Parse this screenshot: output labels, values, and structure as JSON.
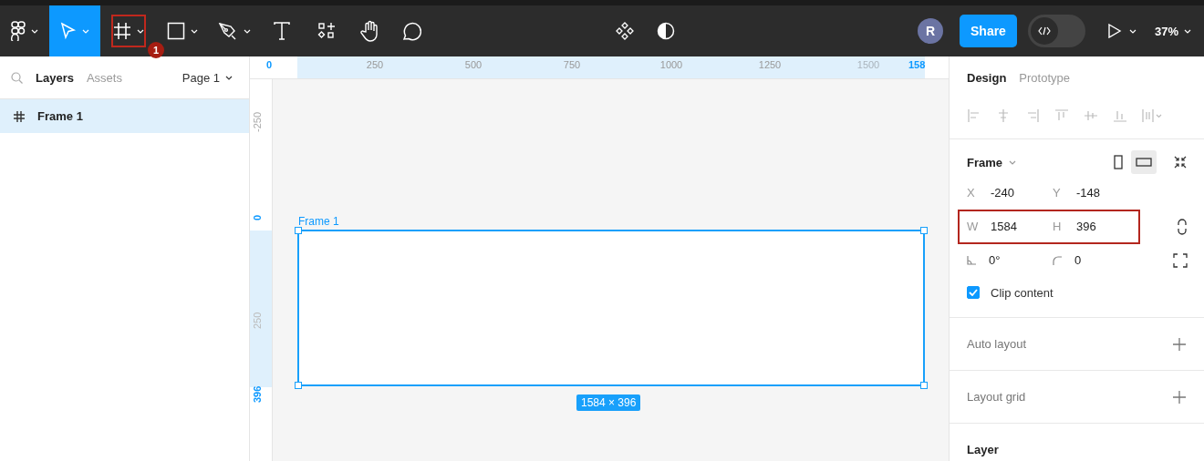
{
  "toolbar": {
    "tools": [
      {
        "kind": "menu",
        "selected": false,
        "dropdown": true,
        "highlighted": false
      },
      {
        "kind": "move",
        "selected": true,
        "dropdown": true,
        "highlighted": false
      },
      {
        "kind": "frame",
        "selected": false,
        "dropdown": true,
        "highlighted": true,
        "badge": "1"
      },
      {
        "kind": "shape",
        "selected": false,
        "dropdown": true,
        "highlighted": false
      },
      {
        "kind": "pen",
        "selected": false,
        "dropdown": true,
        "highlighted": false
      },
      {
        "kind": "text",
        "selected": false,
        "dropdown": false,
        "highlighted": false
      },
      {
        "kind": "resources",
        "selected": false,
        "dropdown": false,
        "highlighted": false
      },
      {
        "kind": "hand",
        "selected": false,
        "dropdown": false,
        "highlighted": false
      },
      {
        "kind": "comment",
        "selected": false,
        "dropdown": false,
        "highlighted": false
      }
    ],
    "avatar": "R",
    "share": "Share",
    "dev_mode": {
      "on": false
    },
    "zoom": "37%"
  },
  "left_panel": {
    "tabs": [
      {
        "label": "Layers",
        "selected": true
      },
      {
        "label": "Assets",
        "selected": false
      }
    ],
    "page": "Page 1",
    "layers": [
      {
        "name": "Frame 1",
        "selected": true
      }
    ]
  },
  "top_ruler": [
    {
      "label": "0",
      "kind": "edge"
    },
    {
      "label": "250",
      "kind": "tick"
    },
    {
      "label": "500",
      "kind": "tick"
    },
    {
      "label": "750",
      "kind": "tick"
    },
    {
      "label": "1000",
      "kind": "tick"
    },
    {
      "label": "1250",
      "kind": "tick"
    },
    {
      "label": "1500",
      "kind": "faded"
    },
    {
      "label": "158",
      "kind": "edge"
    }
  ],
  "left_ruler": [
    {
      "label": "-250",
      "kind": "tick"
    },
    {
      "label": "0",
      "kind": "edge"
    },
    {
      "label": "250",
      "kind": "faded"
    },
    {
      "label": "396",
      "kind": "edge"
    }
  ],
  "canvas": {
    "frame": {
      "name": "Frame 1",
      "size": "1584 × 396",
      "selected": true
    }
  },
  "right_panel": {
    "tabs": [
      {
        "label": "Design",
        "selected": true
      },
      {
        "label": "Prototype",
        "selected": false
      }
    ],
    "frame": {
      "title": "Frame",
      "orientation": [
        {
          "kind": "portrait",
          "selected": false
        },
        {
          "kind": "landscape",
          "selected": true
        }
      ],
      "rows": [
        {
          "highlighted": false,
          "fields": [
            {
              "label": "X",
              "value": "-240"
            },
            {
              "label": "Y",
              "value": "-148"
            }
          ]
        },
        {
          "highlighted": true,
          "fields": [
            {
              "label": "W",
              "value": "1584"
            },
            {
              "label": "H",
              "value": "396"
            }
          ]
        },
        {
          "highlighted": false,
          "fields": [
            {
              "kind": "rotation",
              "value": "0°"
            },
            {
              "kind": "radius",
              "value": "0"
            }
          ]
        }
      ],
      "clip_content": {
        "label": "Clip content",
        "checked": true
      }
    },
    "sections": [
      {
        "title": "Auto layout",
        "addable": true
      },
      {
        "title": "Layout grid",
        "addable": true
      },
      {
        "title": "Layer",
        "addable": false
      }
    ]
  }
}
